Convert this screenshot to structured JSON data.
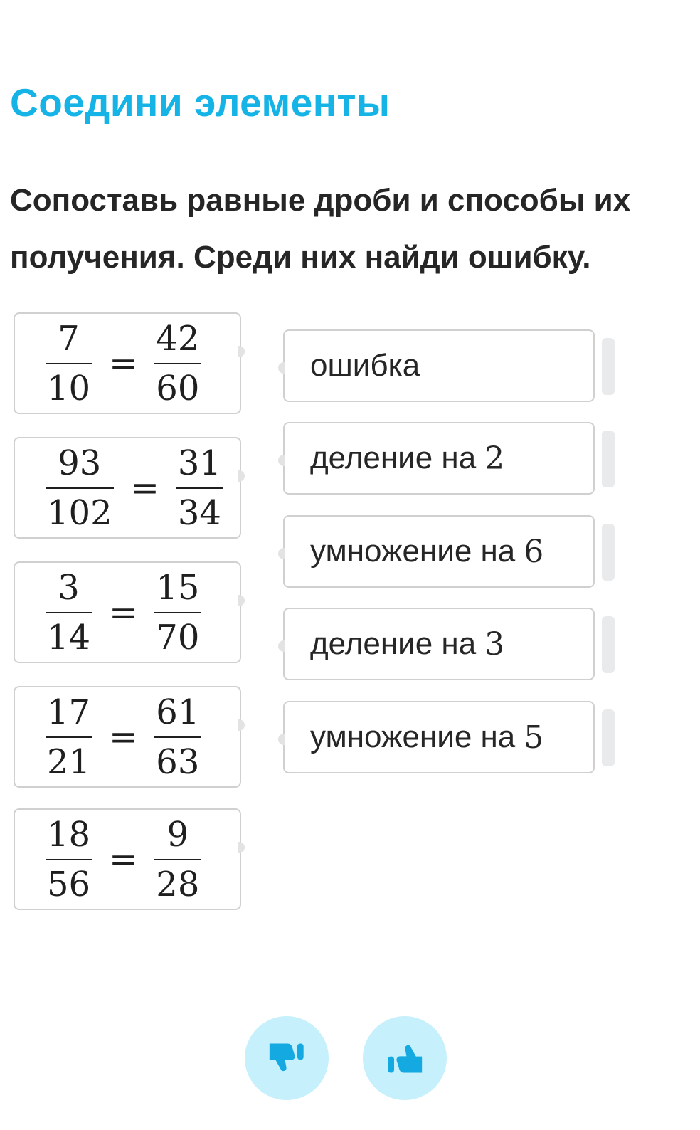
{
  "task": {
    "title": "Соедини элементы",
    "instruction_line1": "Сопоставь равные дроби и способы их",
    "instruction_line2": "получения. Среди них найди ошибку."
  },
  "fractions": [
    {
      "left_num": "7",
      "left_den": "10",
      "sign": "=",
      "right_num": "42",
      "right_den": "60"
    },
    {
      "left_num": "93",
      "left_den": "102",
      "sign": "=",
      "right_num": "31",
      "right_den": "34"
    },
    {
      "left_num": "3",
      "left_den": "14",
      "sign": "=",
      "right_num": "15",
      "right_den": "70"
    },
    {
      "left_num": "17",
      "left_den": "21",
      "sign": "=",
      "right_num": "61",
      "right_den": "63"
    },
    {
      "left_num": "18",
      "left_den": "56",
      "sign": "=",
      "right_num": "9",
      "right_den": "28"
    }
  ],
  "options": [
    {
      "text": "ошибка",
      "number": ""
    },
    {
      "text": "деление на",
      "number": "2"
    },
    {
      "text": "умножение на",
      "number": "6"
    },
    {
      "text": "деление на",
      "number": "3"
    },
    {
      "text": "умножение на",
      "number": "5"
    }
  ],
  "feedback": {
    "dislike_icon": "thumbs-down-icon",
    "like_icon": "thumbs-up-icon",
    "icon_color": "#14a9e0",
    "button_bg": "#c6f0fb"
  }
}
